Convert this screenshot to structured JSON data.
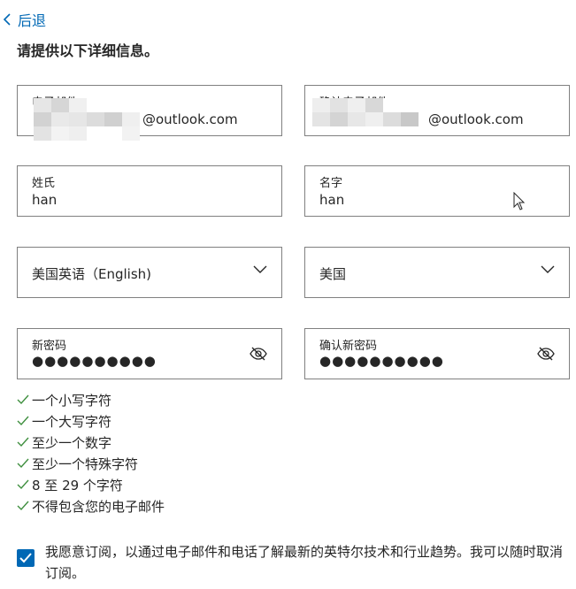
{
  "nav": {
    "back_label": "后退"
  },
  "form": {
    "heading": "请提供以下详细信息。",
    "email": {
      "label": "电子邮件",
      "suffix": "@outlook.com"
    },
    "confirm_email": {
      "label": "确认电子邮件",
      "suffix": "@outlook.com"
    },
    "last_name": {
      "label": "姓氏",
      "value": "han"
    },
    "first_name": {
      "label": "名字",
      "value": "han"
    },
    "language": {
      "value": "美国英语（English)"
    },
    "country": {
      "value": "美国"
    },
    "new_password": {
      "label": "新密码",
      "masked": "●●●●●●●●●●"
    },
    "confirm_password": {
      "label": "确认新密码",
      "masked": "●●●●●●●●●●"
    }
  },
  "password_rules": [
    "一个小写字符",
    "一个大写字符",
    "至少一个数字",
    "至少一个特殊字符",
    "8 至 29 个字符",
    "不得包含您的电子邮件"
  ],
  "consent": {
    "checked": true,
    "text": "我愿意订阅，以通过电子邮件和电话了解最新的英特尔技术和行业趋势。我可以随时取消订阅。"
  },
  "colors": {
    "accent": "#0068b5",
    "check_green": "#3f8f3f",
    "border": "#808080"
  }
}
